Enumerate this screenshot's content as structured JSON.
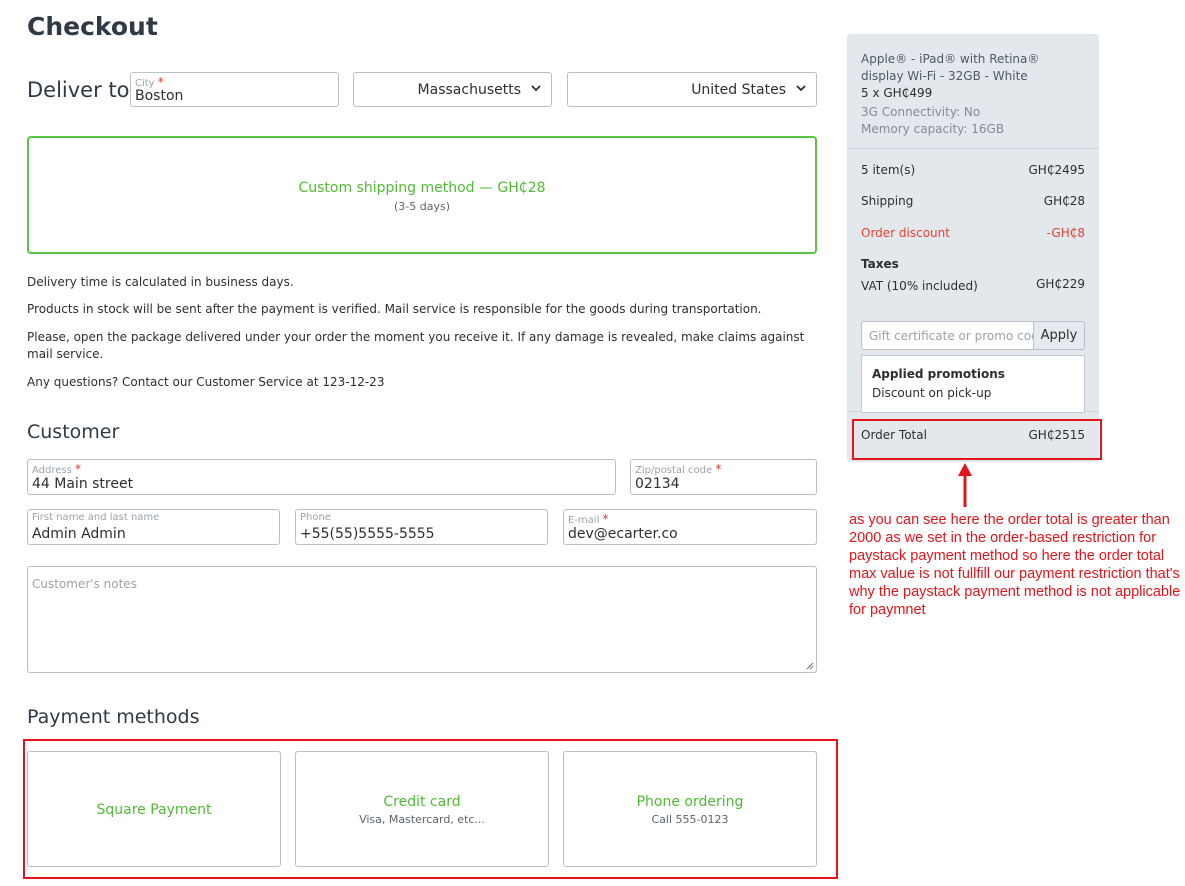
{
  "page": {
    "title": "Checkout"
  },
  "delivery": {
    "label": "Deliver to",
    "city": {
      "label": "City",
      "required_mark": "*",
      "value": "Boston"
    },
    "state": {
      "value": "Massachusetts"
    },
    "country": {
      "value": "United States"
    }
  },
  "shipping": {
    "method_title": "Custom shipping method — GH₵28",
    "method_subtitle": "(3-5 days)",
    "accent_color": "#5ac341"
  },
  "notes": [
    "Delivery time is calculated in business days.",
    "Products in stock will be sent after the payment is verified. Mail service is responsible for the goods during transportation.",
    "Please, open the package delivered under your order the moment you receive it. If any damage is revealed, make claims against mail service.",
    "Any questions? Contact our Customer Service at 123-12-23"
  ],
  "customer": {
    "section_title": "Customer",
    "address": {
      "label": "Address",
      "required_mark": "*",
      "value": "44 Main street"
    },
    "zip": {
      "label": "Zip/postal code",
      "required_mark": "*",
      "value": "02134"
    },
    "name": {
      "label": "First name and last name",
      "value": "Admin Admin"
    },
    "phone": {
      "label": "Phone",
      "value": "+55(55)5555-5555"
    },
    "email": {
      "label": "E-mail",
      "required_mark": "*",
      "value": "dev@ecarter.co"
    },
    "notes_placeholder": "Customer's notes"
  },
  "payment": {
    "section_title": "Payment methods",
    "methods": [
      {
        "title": "Square Payment",
        "subtitle": ""
      },
      {
        "title": "Credit card",
        "subtitle": "Visa, Mastercard, etc..."
      },
      {
        "title": "Phone ordering",
        "subtitle": "Call 555-0123"
      }
    ]
  },
  "summary": {
    "product_name_line1": "Apple® - iPad® with Retina®",
    "product_name_line2": "display Wi-Fi - 32GB - White",
    "product_qty_price": "5 x GH₵499",
    "option_1": "3G Connectivity: No",
    "option_2": "Memory capacity: 16GB",
    "items_label": "5 item(s)",
    "items_value": "GH₵2495",
    "shipping_label": "Shipping",
    "shipping_value": "GH₵28",
    "discount_label": "Order discount",
    "discount_value": "-GH₵8",
    "taxes_label": "Taxes",
    "vat_label": "VAT (10% included)",
    "vat_value": "GH₵229",
    "promo_placeholder": "Gift certificate or promo code",
    "apply_label": "Apply",
    "applied_title": "Applied promotions",
    "applied_item": "Discount on pick-up",
    "total_label": "Order Total",
    "total_value": "GH₵2515"
  },
  "annotation": {
    "text": "as you can see here the order total is greater than 2000 as we set in the order-based restriction for paystack payment method so here the order total max value is not  fullfill our payment restriction that's why the paystack payment method is not applicable  for paymnet",
    "color": "#e5141b"
  },
  "icons": {
    "select_chevron": "chevron-down-icon",
    "resize_handle": "resize-handle-icon",
    "annotation_arrow": "arrow-up-icon"
  }
}
